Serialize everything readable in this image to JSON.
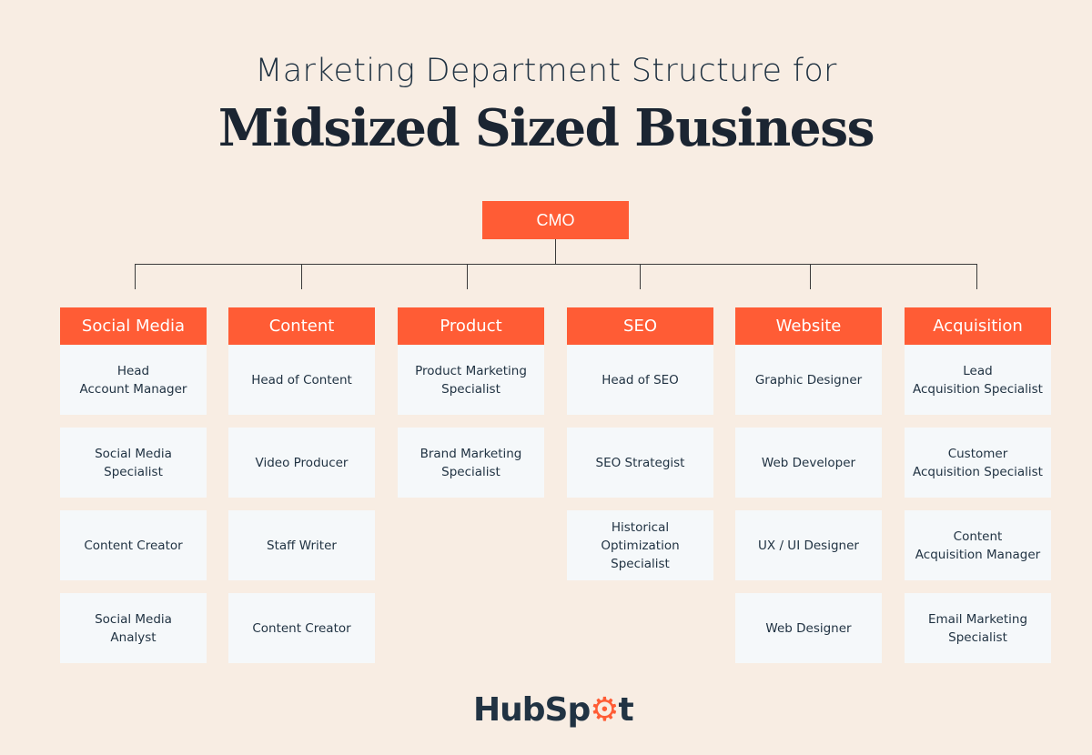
{
  "header": {
    "subtitle": "Marketing Department Structure for",
    "title": "Midsized Sized Business"
  },
  "root": {
    "label": "CMO"
  },
  "departments": [
    {
      "name": "Social Media",
      "roles": [
        "Head\nAccount Manager",
        "Social Media\nSpecialist",
        "Content Creator",
        "Social Media\nAnalyst"
      ]
    },
    {
      "name": "Content",
      "roles": [
        "Head of Content",
        "Video Producer",
        "Staff Writer",
        "Content Creator"
      ]
    },
    {
      "name": "Product",
      "roles": [
        "Product Marketing\nSpecialist",
        "Brand Marketing\nSpecialist"
      ]
    },
    {
      "name": "SEO",
      "roles": [
        "Head of SEO",
        "SEO Strategist",
        "Historical\nOptimization\nSpecialist"
      ]
    },
    {
      "name": "Website",
      "roles": [
        "Graphic Designer",
        "Web Developer",
        "UX / UI Designer",
        "Web Designer"
      ]
    },
    {
      "name": "Acquisition",
      "roles": [
        "Lead\nAcquisition Specialist",
        "Customer\nAcquisition Specialist",
        "Content\nAcquisition Manager",
        "Email Marketing\nSpecialist"
      ]
    }
  ],
  "logo": {
    "text_before": "HubSp",
    "text_o": "o",
    "text_after": "t",
    "icon": "hubspot-sprocket-icon"
  },
  "colors": {
    "accent": "#ff5c35",
    "background": "#f8ede3",
    "card": "#f5f8fa",
    "text": "#213343"
  }
}
